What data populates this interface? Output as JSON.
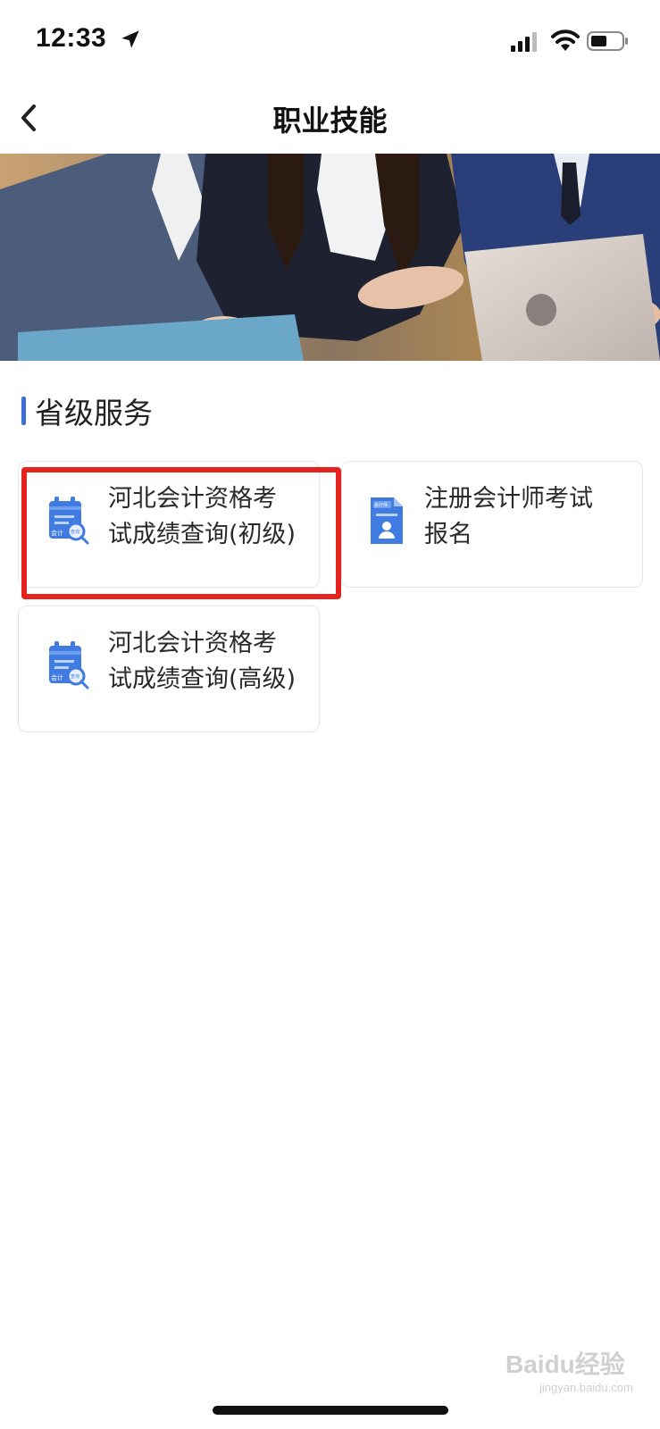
{
  "status_bar": {
    "time": "12:33",
    "location_icon": "location-arrow-icon",
    "signal_icon": "cellular-signal-icon",
    "wifi_icon": "wifi-icon",
    "battery_icon": "battery-icon"
  },
  "nav": {
    "title": "职业技能",
    "back_icon": "chevron-left-icon"
  },
  "banner": {
    "image": "office-team-laptop-photo"
  },
  "section": {
    "title": "省级服务"
  },
  "services": [
    {
      "line1": "河北会计资格考",
      "line2": "试成绩查询(初级)",
      "icon": "calendar-search-icon",
      "icon_text_left": "会计",
      "icon_text_right": "查询"
    },
    {
      "line1": "注册会计师考试",
      "line2": "报名",
      "icon": "registration-form-icon",
      "icon_text": "会计师"
    },
    {
      "line1": "河北会计资格考",
      "line2": "试成绩查询(高级)",
      "icon": "calendar-search-icon",
      "icon_text_left": "会计",
      "icon_text_right": "查询"
    }
  ],
  "highlight_color": "#e4231f",
  "accent_color": "#3d6fd6",
  "watermark": {
    "main": "Baidu经验",
    "sub": "jingyan.baidu.com"
  }
}
